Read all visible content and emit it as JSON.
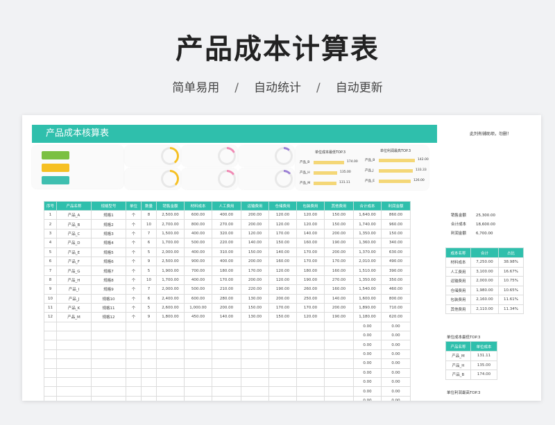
{
  "hero": {
    "title": "产品成本计算表",
    "sub1": "简单易用",
    "sub2": "自动统计",
    "sub3": "自动更新",
    "sep": "/"
  },
  "sheet": {
    "title": "产品成本核算表",
    "note": "此列有辅助项，勿删！",
    "colors": {
      "accent": "#2fbfac",
      "green": "#7bc043",
      "yellow": "#f6c022",
      "teal": "#3fbfb0",
      "bar": "#f4d777"
    },
    "lowest_chart": {
      "title": "单位成本最低TOP.3",
      "items": [
        {
          "name": "产品_B",
          "value": "174.00",
          "ratio": 1.0
        },
        {
          "name": "产品_H",
          "value": "135.00",
          "ratio": 0.78
        },
        {
          "name": "产品_M",
          "value": "131.11",
          "ratio": 0.75
        }
      ]
    },
    "profit_chart": {
      "title": "单位利润最高TOP.3",
      "items": [
        {
          "name": "产品_B",
          "value": "142.00",
          "ratio": 1.0
        },
        {
          "name": "产品_J",
          "value": "133.33",
          "ratio": 0.94
        },
        {
          "name": "产品_E",
          "value": "126.00",
          "ratio": 0.89
        }
      ]
    },
    "table": {
      "headers": [
        "序号",
        "产品名称",
        "规格型号",
        "单位",
        "数量",
        "销售金额",
        "材料成本",
        "人工费用",
        "运输费用",
        "仓储费用",
        "包装费用",
        "其他费用",
        "合计成本",
        "利润金额"
      ],
      "rows": [
        [
          "1",
          "产品_A",
          "规格1",
          "个",
          "8",
          "2,500.00",
          "600.00",
          "400.00",
          "200.00",
          "120.00",
          "120.00",
          "150.00",
          "1,640.00",
          "860.00"
        ],
        [
          "2",
          "产品_B",
          "规格2",
          "个",
          "10",
          "2,700.00",
          "800.00",
          "270.00",
          "200.00",
          "120.00",
          "120.00",
          "150.00",
          "1,740.00",
          "960.00"
        ],
        [
          "3",
          "产品_C",
          "规格3",
          "个",
          "7",
          "1,500.00",
          "400.00",
          "320.00",
          "120.00",
          "170.00",
          "140.00",
          "200.00",
          "1,350.00",
          "150.00"
        ],
        [
          "4",
          "产品_D",
          "规格4",
          "个",
          "6",
          "1,700.00",
          "500.00",
          "220.00",
          "140.00",
          "150.00",
          "160.00",
          "190.00",
          "1,360.00",
          "340.00"
        ],
        [
          "5",
          "产品_E",
          "规格5",
          "个",
          "5",
          "2,000.00",
          "400.00",
          "310.00",
          "150.00",
          "140.00",
          "170.00",
          "200.00",
          "1,370.00",
          "630.00"
        ],
        [
          "6",
          "产品_F",
          "规格6",
          "个",
          "9",
          "2,500.00",
          "900.00",
          "400.00",
          "200.00",
          "160.00",
          "170.00",
          "170.00",
          "2,010.00",
          "490.00"
        ],
        [
          "7",
          "产品_G",
          "规格7",
          "个",
          "5",
          "1,900.00",
          "700.00",
          "180.00",
          "170.00",
          "120.00",
          "180.00",
          "160.00",
          "1,510.00",
          "390.00"
        ],
        [
          "8",
          "产品_H",
          "规格8",
          "个",
          "10",
          "1,700.00",
          "400.00",
          "170.00",
          "200.00",
          "120.00",
          "190.00",
          "270.00",
          "1,350.00",
          "350.00"
        ],
        [
          "9",
          "产品_I",
          "规格9",
          "个",
          "7",
          "2,000.00",
          "500.00",
          "210.00",
          "220.00",
          "190.00",
          "260.00",
          "160.00",
          "1,540.00",
          "460.00"
        ],
        [
          "10",
          "产品_J",
          "规格10",
          "个",
          "6",
          "2,400.00",
          "600.00",
          "280.00",
          "130.00",
          "200.00",
          "250.00",
          "140.00",
          "1,600.00",
          "800.00"
        ],
        [
          "11",
          "产品_K",
          "规格11",
          "个",
          "5",
          "2,600.00",
          "1,000.00",
          "200.00",
          "150.00",
          "170.00",
          "170.00",
          "200.00",
          "1,890.00",
          "710.00"
        ],
        [
          "12",
          "产品_M",
          "规格12",
          "个",
          "9",
          "1,800.00",
          "450.00",
          "140.00",
          "130.00",
          "150.00",
          "120.00",
          "190.00",
          "1,180.00",
          "620.00"
        ]
      ],
      "empty_total": "0.00",
      "empty_profit": "0.00"
    },
    "summary": [
      {
        "label": "销售金额",
        "value": "25,300.00"
      },
      {
        "label": "合计成本",
        "value": "18,600.00"
      },
      {
        "label": "利润金额",
        "value": "6,700.00"
      }
    ],
    "cost_table": {
      "headers": [
        "成本名称",
        "合计",
        "占比"
      ],
      "rows": [
        [
          "材料成本",
          "7,250.00",
          "38.98%"
        ],
        [
          "人工费用",
          "3,100.00",
          "16.67%"
        ],
        [
          "运输费用",
          "2,000.00",
          "10.75%"
        ],
        [
          "仓储费用",
          "1,980.00",
          "10.65%"
        ],
        [
          "包装费用",
          "2,160.00",
          "11.61%"
        ],
        [
          "其他费用",
          "2,110.00",
          "11.34%"
        ]
      ]
    },
    "low_table": {
      "title": "单位成本最低TOP.3",
      "headers": [
        "产品名称",
        "单位成本"
      ],
      "rows": [
        [
          "产品_M",
          "131.11"
        ],
        [
          "产品_H",
          "135.00"
        ],
        [
          "产品_B",
          "174.00"
        ]
      ]
    },
    "profit_table_title": "单位利润最高TOP.3"
  }
}
